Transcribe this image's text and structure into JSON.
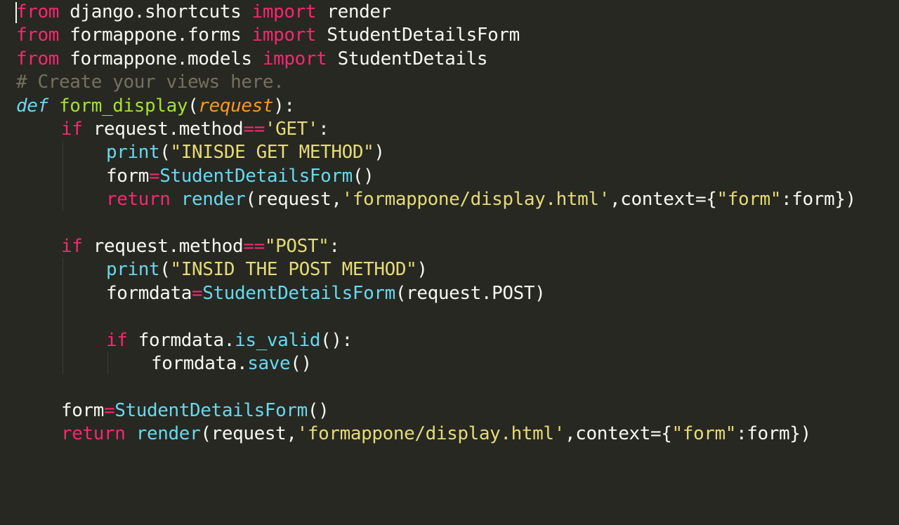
{
  "editor": {
    "theme_colors": {
      "background": "#272822",
      "text": "#f8f8f2",
      "keyword": "#f92672",
      "string": "#e6db74",
      "builtin": "#66d9ef",
      "function_name": "#a6e22e",
      "parameter": "#fd971f",
      "comment": "#75715e"
    },
    "lines": [
      {
        "indent": 0,
        "tokens": [
          {
            "t": "from",
            "k": "keyword"
          },
          {
            "t": " django.shortcuts ",
            "k": "plain"
          },
          {
            "t": "import",
            "k": "keyword"
          },
          {
            "t": " render",
            "k": "plain"
          }
        ]
      },
      {
        "indent": 0,
        "tokens": [
          {
            "t": "from",
            "k": "keyword"
          },
          {
            "t": " formappone.forms ",
            "k": "plain"
          },
          {
            "t": "import",
            "k": "keyword"
          },
          {
            "t": " StudentDetailsForm",
            "k": "plain"
          }
        ]
      },
      {
        "indent": 0,
        "tokens": [
          {
            "t": "from",
            "k": "keyword"
          },
          {
            "t": " formappone.models ",
            "k": "plain"
          },
          {
            "t": "import",
            "k": "keyword"
          },
          {
            "t": " StudentDetails",
            "k": "plain"
          }
        ]
      },
      {
        "indent": 0,
        "tokens": [
          {
            "t": "# Create your views here.",
            "k": "comment"
          }
        ]
      },
      {
        "indent": 0,
        "tokens": [
          {
            "t": "def",
            "k": "defkw"
          },
          {
            "t": " ",
            "k": "plain"
          },
          {
            "t": "form_display",
            "k": "funcname"
          },
          {
            "t": "(",
            "k": "plain"
          },
          {
            "t": "request",
            "k": "param"
          },
          {
            "t": "):",
            "k": "plain"
          }
        ]
      },
      {
        "indent": 1,
        "tokens": [
          {
            "t": "if",
            "k": "keyword"
          },
          {
            "t": " request.method",
            "k": "plain"
          },
          {
            "t": "==",
            "k": "operator"
          },
          {
            "t": "'GET'",
            "k": "string"
          },
          {
            "t": ":",
            "k": "plain"
          }
        ]
      },
      {
        "indent": 2,
        "tokens": [
          {
            "t": "print",
            "k": "builtin"
          },
          {
            "t": "(",
            "k": "plain"
          },
          {
            "t": "\"INISDE GET METHOD\"",
            "k": "string"
          },
          {
            "t": ")",
            "k": "plain"
          }
        ]
      },
      {
        "indent": 2,
        "tokens": [
          {
            "t": "form",
            "k": "plain"
          },
          {
            "t": "=",
            "k": "operator"
          },
          {
            "t": "StudentDetailsForm",
            "k": "builtin"
          },
          {
            "t": "()",
            "k": "plain"
          }
        ]
      },
      {
        "indent": 2,
        "tokens": [
          {
            "t": "return",
            "k": "keyword"
          },
          {
            "t": " ",
            "k": "plain"
          },
          {
            "t": "render",
            "k": "builtin"
          },
          {
            "t": "(request,",
            "k": "plain"
          },
          {
            "t": "'formappone/display.html'",
            "k": "string"
          },
          {
            "t": ",context={",
            "k": "plain"
          },
          {
            "t": "\"form\"",
            "k": "string"
          },
          {
            "t": ":form})",
            "k": "plain"
          }
        ]
      },
      {
        "indent": 0,
        "tokens": []
      },
      {
        "indent": 1,
        "tokens": [
          {
            "t": "if",
            "k": "keyword"
          },
          {
            "t": " request.method",
            "k": "plain"
          },
          {
            "t": "==",
            "k": "operator"
          },
          {
            "t": "\"POST\"",
            "k": "string"
          },
          {
            "t": ":",
            "k": "plain"
          }
        ]
      },
      {
        "indent": 2,
        "tokens": [
          {
            "t": "print",
            "k": "builtin"
          },
          {
            "t": "(",
            "k": "plain"
          },
          {
            "t": "\"INSID THE POST METHOD\"",
            "k": "string"
          },
          {
            "t": ")",
            "k": "plain"
          }
        ]
      },
      {
        "indent": 2,
        "tokens": [
          {
            "t": "formdata",
            "k": "plain"
          },
          {
            "t": "=",
            "k": "operator"
          },
          {
            "t": "StudentDetailsForm",
            "k": "builtin"
          },
          {
            "t": "(request.POST)",
            "k": "plain"
          }
        ]
      },
      {
        "indent": 0,
        "tokens": []
      },
      {
        "indent": 2,
        "tokens": [
          {
            "t": "if",
            "k": "keyword"
          },
          {
            "t": " formdata.",
            "k": "plain"
          },
          {
            "t": "is_valid",
            "k": "builtin"
          },
          {
            "t": "():",
            "k": "plain"
          }
        ]
      },
      {
        "indent": 3,
        "tokens": [
          {
            "t": "formdata.",
            "k": "plain"
          },
          {
            "t": "save",
            "k": "builtin"
          },
          {
            "t": "()",
            "k": "plain"
          }
        ]
      },
      {
        "indent": 0,
        "tokens": []
      },
      {
        "indent": 1,
        "tokens": [
          {
            "t": "form",
            "k": "plain"
          },
          {
            "t": "=",
            "k": "operator"
          },
          {
            "t": "StudentDetailsForm",
            "k": "builtin"
          },
          {
            "t": "()",
            "k": "plain"
          }
        ]
      },
      {
        "indent": 1,
        "tokens": [
          {
            "t": "return",
            "k": "keyword"
          },
          {
            "t": " ",
            "k": "plain"
          },
          {
            "t": "render",
            "k": "builtin"
          },
          {
            "t": "(request,",
            "k": "plain"
          },
          {
            "t": "'formappone/display.html'",
            "k": "string"
          },
          {
            "t": ",context={",
            "k": "plain"
          },
          {
            "t": "\"form\"",
            "k": "string"
          },
          {
            "t": ":form})",
            "k": "plain"
          }
        ]
      }
    ]
  }
}
